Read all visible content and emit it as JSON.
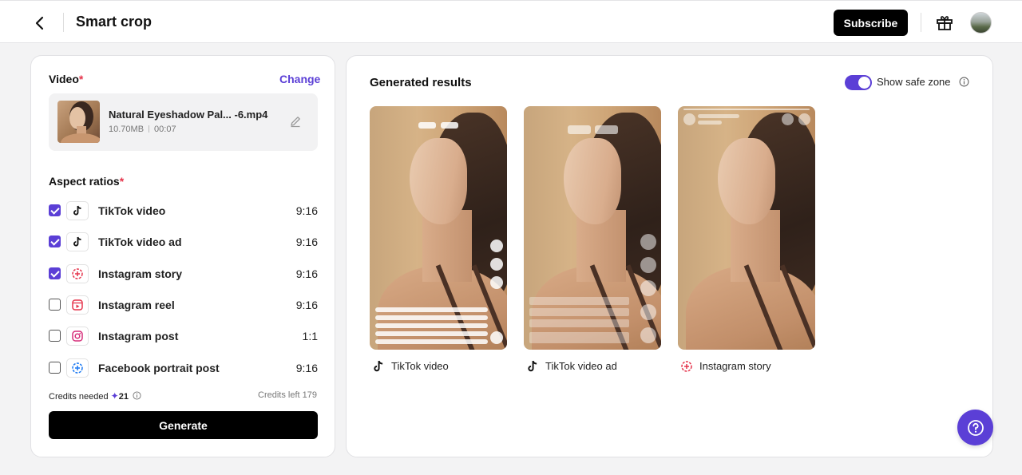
{
  "header": {
    "title": "Smart crop",
    "subscribe_label": "Subscribe"
  },
  "video_section": {
    "label": "Video",
    "required_mark": "*",
    "change_label": "Change",
    "file": {
      "name": "Natural Eyeshadow Pal... -6.mp4",
      "size": "10.70MB",
      "duration": "00:07"
    }
  },
  "aspect_section": {
    "label": "Aspect ratios",
    "required_mark": "*",
    "items": [
      {
        "label": "TikTok video",
        "ratio": "9:16",
        "checked": true,
        "icon": "tiktok-icon"
      },
      {
        "label": "TikTok video ad",
        "ratio": "9:16",
        "checked": true,
        "icon": "tiktok-icon"
      },
      {
        "label": "Instagram story",
        "ratio": "9:16",
        "checked": true,
        "icon": "instagram-story-icon"
      },
      {
        "label": "Instagram reel",
        "ratio": "9:16",
        "checked": false,
        "icon": "instagram-reel-icon"
      },
      {
        "label": "Instagram post",
        "ratio": "1:1",
        "checked": false,
        "icon": "instagram-icon"
      },
      {
        "label": "Facebook portrait post",
        "ratio": "9:16",
        "checked": false,
        "icon": "facebook-story-icon"
      }
    ]
  },
  "credits": {
    "needed_label": "Credits needed",
    "needed_value": "21",
    "left_label": "Credits left 179"
  },
  "generate_label": "Generate",
  "results": {
    "title": "Generated results",
    "toggle_label": "Show safe zone",
    "toggle_on": true,
    "cards": [
      {
        "caption": "TikTok video",
        "icon": "tiktok-icon"
      },
      {
        "caption": "TikTok video ad",
        "icon": "tiktok-icon"
      },
      {
        "caption": "Instagram story",
        "icon": "instagram-story-icon"
      }
    ]
  },
  "colors": {
    "accent": "#5b3fd6",
    "required": "#e5344b",
    "button_dark": "#000000"
  }
}
